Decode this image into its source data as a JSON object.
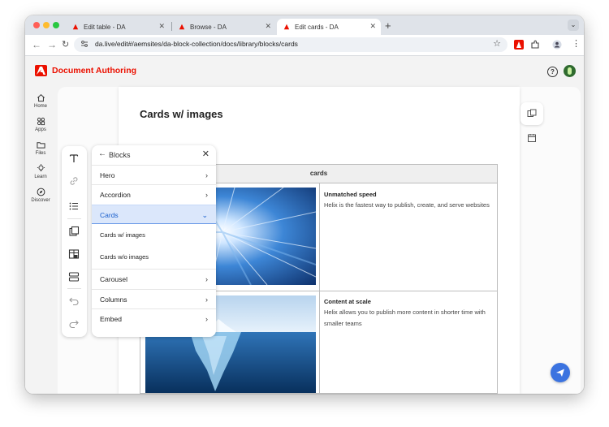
{
  "browser": {
    "tabs": [
      {
        "title": "Edit table - DA",
        "active": false
      },
      {
        "title": "Browse - DA",
        "active": false
      },
      {
        "title": "Edit cards - DA",
        "active": true
      }
    ],
    "url": "da.live/edit#/aemsites/da-block-collection/docs/library/blocks/cards"
  },
  "app": {
    "name": "Document Authoring",
    "accent": "#eb1000"
  },
  "nav": [
    {
      "label": "Home",
      "icon": "home-icon"
    },
    {
      "label": "Apps",
      "icon": "apps-icon"
    },
    {
      "label": "Files",
      "icon": "folder-icon"
    },
    {
      "label": "Learn",
      "icon": "lightbulb-icon"
    },
    {
      "label": "Discover",
      "icon": "discover-icon"
    }
  ],
  "document": {
    "title": "Cards w/ images",
    "block_name": "cards",
    "cards": [
      {
        "heading": "Unmatched speed",
        "text": "Helix is the fastest way to publish, create, and serve websites"
      },
      {
        "heading": "Content at scale",
        "text": "Helix allows you to publish more content in shorter time with smaller teams"
      }
    ]
  },
  "blocks_panel": {
    "title": "Blocks",
    "items": [
      "Hero",
      "Accordion",
      "Cards",
      "Carousel",
      "Columns",
      "Embed"
    ],
    "selected": "Cards",
    "sub_items": [
      "Cards w/ images",
      "Cards w/o images"
    ]
  }
}
